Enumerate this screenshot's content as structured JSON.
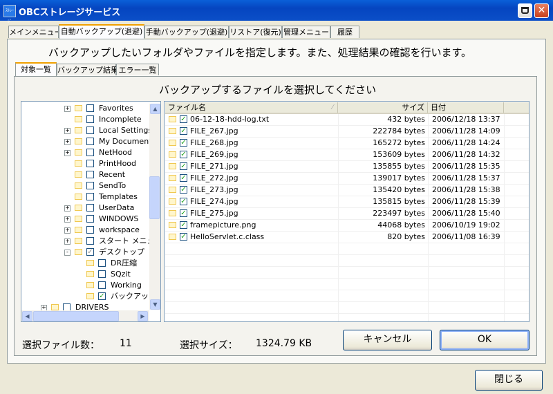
{
  "window": {
    "title": "OBCストレージサービス",
    "icon_text": "ｽﾄﾚｰｼﾞ",
    "close_glyph": "✕"
  },
  "main_tabs": [
    {
      "label": "メインメニュー",
      "active": false
    },
    {
      "label": "自動バックアップ(退避)",
      "active": true
    },
    {
      "label": "手動バックアップ(退避)",
      "active": false
    },
    {
      "label": "リストア(復元)",
      "active": false
    },
    {
      "label": "管理メニュー",
      "active": false
    },
    {
      "label": "履歴",
      "active": false
    }
  ],
  "description": "バックアップしたいフォルダやファイルを指定します。また、処理結果の確認を行います。",
  "sub_tabs": [
    {
      "label": "対象一覧",
      "active": true
    },
    {
      "label": "バックアップ結果",
      "active": false
    },
    {
      "label": "エラー一覧",
      "active": false
    }
  ],
  "panel_title": "バックアップするファイルを選択してください",
  "tree_items": [
    {
      "label": "Favorites",
      "depth": 0,
      "expander": "+",
      "state": "unchecked"
    },
    {
      "label": "Incomplete",
      "depth": 0,
      "expander": "",
      "state": "unchecked"
    },
    {
      "label": "Local Settings",
      "depth": 0,
      "expander": "+",
      "state": "unchecked"
    },
    {
      "label": "My Documents",
      "depth": 0,
      "expander": "+",
      "state": "unchecked"
    },
    {
      "label": "NetHood",
      "depth": 0,
      "expander": "+",
      "state": "unchecked"
    },
    {
      "label": "PrintHood",
      "depth": 0,
      "expander": "",
      "state": "unchecked"
    },
    {
      "label": "Recent",
      "depth": 0,
      "expander": "",
      "state": "unchecked"
    },
    {
      "label": "SendTo",
      "depth": 0,
      "expander": "",
      "state": "unchecked"
    },
    {
      "label": "Templates",
      "depth": 0,
      "expander": "",
      "state": "unchecked"
    },
    {
      "label": "UserData",
      "depth": 0,
      "expander": "+",
      "state": "unchecked"
    },
    {
      "label": "WINDOWS",
      "depth": 0,
      "expander": "+",
      "state": "unchecked"
    },
    {
      "label": "workspace",
      "depth": 0,
      "expander": "+",
      "state": "unchecked"
    },
    {
      "label": "スタート メニュー",
      "depth": 0,
      "expander": "+",
      "state": "unchecked"
    },
    {
      "label": "デスクトップ",
      "depth": 0,
      "expander": "-",
      "state": "partial"
    },
    {
      "label": "DR圧縮",
      "depth": 1,
      "expander": "",
      "state": "unchecked"
    },
    {
      "label": "SQzit",
      "depth": 1,
      "expander": "",
      "state": "unchecked"
    },
    {
      "label": "Working",
      "depth": 1,
      "expander": "",
      "state": "unchecked"
    },
    {
      "label": "バックアップ",
      "depth": 1,
      "expander": "",
      "state": "checked"
    },
    {
      "label": "DRIVERS",
      "depth": -2,
      "expander": "+",
      "state": "unchecked"
    }
  ],
  "list": {
    "columns": [
      "ファイル名",
      "サイズ",
      "日付"
    ],
    "rows": [
      {
        "name": "06-12-18-hdd-log.txt",
        "size": "432 bytes",
        "date": "2006/12/18 13:37"
      },
      {
        "name": "FILE_267.jpg",
        "size": "222784 bytes",
        "date": "2006/11/28 14:09"
      },
      {
        "name": "FILE_268.jpg",
        "size": "165272 bytes",
        "date": "2006/11/28 14:24"
      },
      {
        "name": "FILE_269.jpg",
        "size": "153609 bytes",
        "date": "2006/11/28 14:32"
      },
      {
        "name": "FILE_271.jpg",
        "size": "135855 bytes",
        "date": "2006/11/28 15:35"
      },
      {
        "name": "FILE_272.jpg",
        "size": "139017 bytes",
        "date": "2006/11/28 15:37"
      },
      {
        "name": "FILE_273.jpg",
        "size": "135420 bytes",
        "date": "2006/11/28 15:38"
      },
      {
        "name": "FILE_274.jpg",
        "size": "135815 bytes",
        "date": "2006/11/28 15:39"
      },
      {
        "name": "FILE_275.jpg",
        "size": "223497 bytes",
        "date": "2006/11/28 15:40"
      },
      {
        "name": "framepicture.png",
        "size": "44068 bytes",
        "date": "2006/10/19 19:02"
      },
      {
        "name": "HelloServlet.c.class",
        "size": "820 bytes",
        "date": "2006/11/08 16:39"
      }
    ]
  },
  "status": {
    "file_count_label": "選択ファイル数：",
    "file_count": "11",
    "size_label": "選択サイズ：",
    "size_value": "1324.79 KB"
  },
  "buttons": {
    "cancel": "キャンセル",
    "ok": "OK",
    "close": "閉じる"
  }
}
